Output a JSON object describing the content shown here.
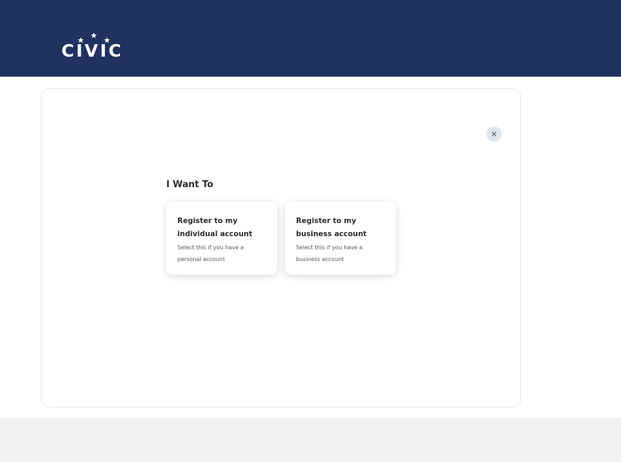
{
  "header": {
    "brand": "CIVIC",
    "background": "#213260"
  },
  "dialog": {
    "close_label": "×",
    "heading": "I Want To",
    "options": [
      {
        "title": "Register to my individual account",
        "description": "Select this if you have a personal account"
      },
      {
        "title": "Register to my business account",
        "description": "Select this if you have a business account"
      }
    ]
  }
}
